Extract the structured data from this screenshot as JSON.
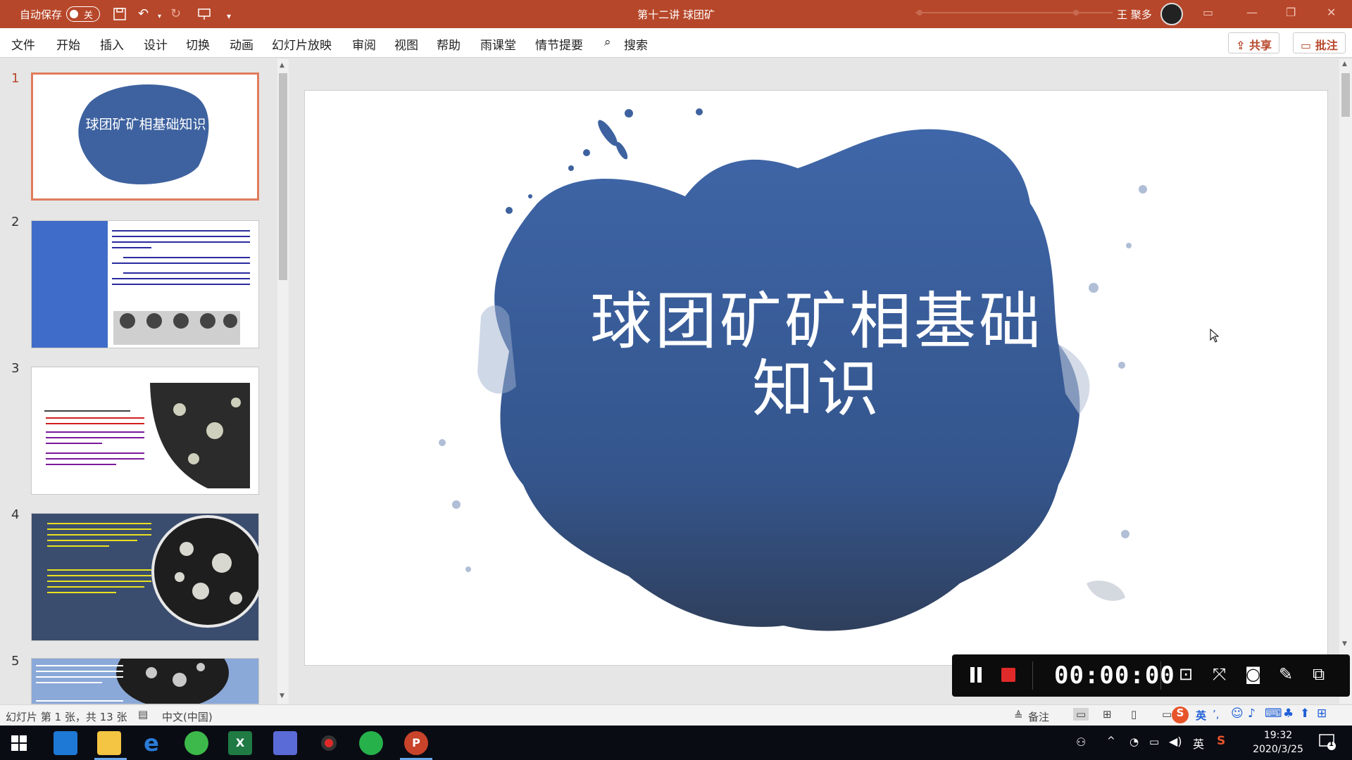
{
  "titlebar": {
    "autosave_label": "自动保存",
    "autosave_state": "关",
    "doc_title": "第十二讲 球团矿",
    "user": "王 聚多"
  },
  "menu": {
    "items": [
      "文件",
      "开始",
      "插入",
      "设计",
      "切换",
      "动画",
      "幻灯片放映",
      "审阅",
      "视图",
      "帮助",
      "雨课堂",
      "情节提要"
    ],
    "search_label": "搜索",
    "share_label": "共享",
    "comment_label": "批注"
  },
  "thumbnails": [
    {
      "num": "1",
      "title": "球团矿矿相基础知识"
    },
    {
      "num": "2"
    },
    {
      "num": "3"
    },
    {
      "num": "4"
    },
    {
      "num": "5"
    }
  ],
  "slide": {
    "title_line1": "球团矿矿相基础",
    "title_line2": "知识"
  },
  "recorder": {
    "timer": "00:00:00"
  },
  "status": {
    "slide_info": "幻灯片 第 1 张，共 13 张",
    "language": "中文(中国)",
    "notes_label": "备注"
  },
  "taskbar": {
    "ime": "英",
    "time": "19:32",
    "date": "2020/3/25",
    "notif_count": "1"
  },
  "colors": {
    "brand": "#b7472a",
    "slide_blob": "#3e629f",
    "recorder_bg": "#0c0c0c",
    "record_red": "#e02a2a"
  }
}
